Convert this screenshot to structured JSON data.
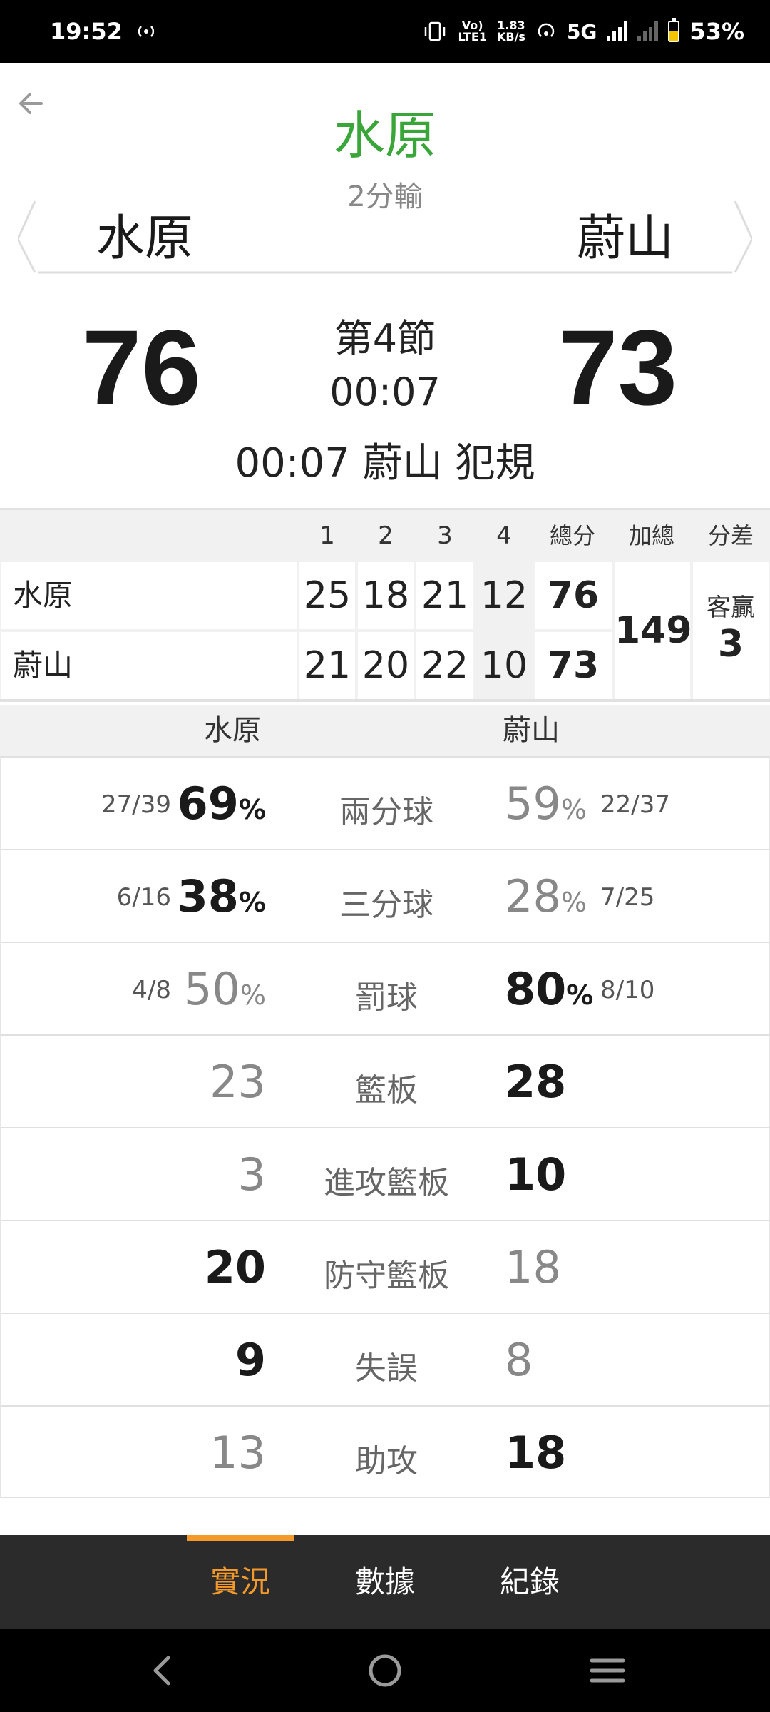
{
  "status_bar": {
    "time": "19:52",
    "net_speed_top": "1.83",
    "net_speed_bottom": "KB/s",
    "volte_top": "Vo)",
    "volte_bottom": "LTE1",
    "network": "5G",
    "battery": "53%"
  },
  "header": {
    "team_title": "水原",
    "result": "2分輸",
    "left_team": "水原",
    "right_team": "蔚山",
    "left_score": "76",
    "right_score": "73",
    "period": "第4節",
    "clock": "00:07",
    "last_event": "00:07 蔚山  犯規"
  },
  "quarter_table": {
    "headers": [
      "1",
      "2",
      "3",
      "4",
      "總分",
      "加總",
      "分差"
    ],
    "rows": [
      {
        "team": "水原",
        "q": [
          "25",
          "18",
          "21",
          "12"
        ],
        "total": "76"
      },
      {
        "team": "蔚山",
        "q": [
          "21",
          "20",
          "22",
          "10"
        ],
        "total": "73"
      }
    ],
    "sum": "149",
    "diff_label": "客贏",
    "diff_value": "3"
  },
  "stats_header": {
    "left": "水原",
    "right": "蔚山"
  },
  "stats": [
    {
      "label": "兩分球",
      "left_frac": "27/39",
      "left_val": "69",
      "left_pct": "%",
      "right_val": "59",
      "right_pct": "%",
      "right_frac": "22/37"
    },
    {
      "label": "三分球",
      "left_frac": "6/16",
      "left_val": "38",
      "left_pct": "%",
      "right_val": "28",
      "right_pct": "%",
      "right_frac": "7/25"
    },
    {
      "label": "罰球",
      "left_frac": "4/8",
      "left_val": "50",
      "left_pct": "%",
      "right_val": "80",
      "right_pct": "%",
      "right_frac": "8/10"
    },
    {
      "label": "籃板",
      "left_frac": "",
      "left_val": "23",
      "left_pct": "",
      "right_val": "28",
      "right_pct": "",
      "right_frac": ""
    },
    {
      "label": "進攻籃板",
      "left_frac": "",
      "left_val": "3",
      "left_pct": "",
      "right_val": "10",
      "right_pct": "",
      "right_frac": ""
    },
    {
      "label": "防守籃板",
      "left_frac": "",
      "left_val": "20",
      "left_pct": "",
      "right_val": "18",
      "right_pct": "",
      "right_frac": ""
    },
    {
      "label": "失誤",
      "left_frac": "",
      "left_val": "9",
      "left_pct": "",
      "right_val": "8",
      "right_pct": "",
      "right_frac": ""
    },
    {
      "label": "助攻",
      "left_frac": "",
      "left_val": "13",
      "left_pct": "",
      "right_val": "18",
      "right_pct": "",
      "right_frac": ""
    }
  ],
  "tabs": [
    {
      "label": "實況",
      "active": true
    },
    {
      "label": "數據",
      "active": false
    },
    {
      "label": "紀錄",
      "active": false
    }
  ],
  "colors": {
    "accent_green": "#3aa63a",
    "tab_active": "#f39a2b",
    "tab_bar_bg": "#2b2b2b"
  },
  "icons": {
    "back": "arrow-left-icon",
    "nav_back": "chevron-left-icon",
    "nav_home": "circle-home-icon",
    "nav_menu": "hamburger-menu-icon"
  }
}
